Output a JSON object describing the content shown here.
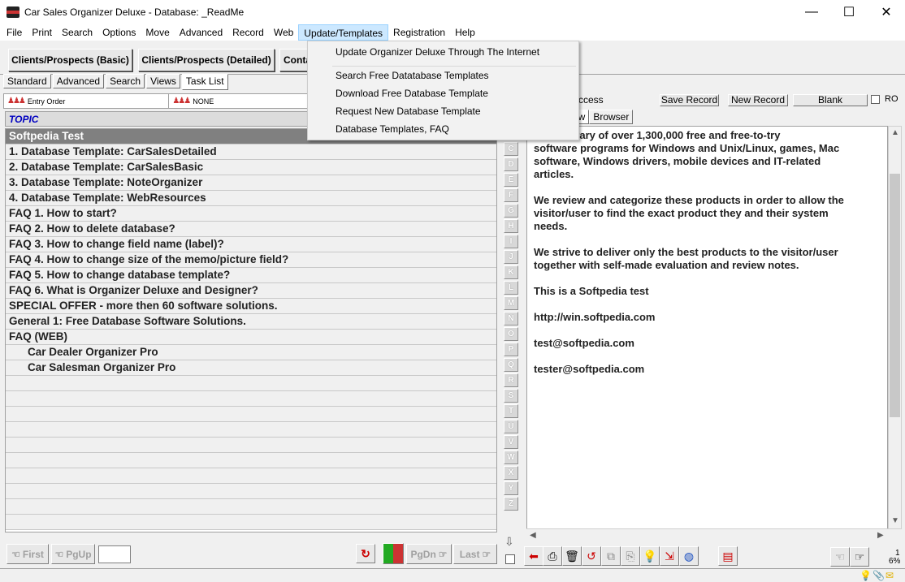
{
  "window": {
    "title": "Car Sales Organizer Deluxe - Database: _ReadMe",
    "controls": [
      "—",
      "☐",
      "✕"
    ]
  },
  "menu": [
    "File",
    "Print",
    "Search",
    "Options",
    "Move",
    "Advanced",
    "Record",
    "Web",
    "Update/Templates",
    "Registration",
    "Help"
  ],
  "active_menu": "Update/Templates",
  "dropdown": {
    "items": [
      "Update Organizer Deluxe Through The Internet",
      "Search Free Datatabase Templates",
      "Download Free Database Template",
      "Request New Database Template",
      "Database Templates, FAQ"
    ]
  },
  "toolbar": {
    "btn1": "Clients/Prospects (Basic)",
    "btn2": "Clients/Prospects (Detailed)",
    "btn3": "Conta"
  },
  "left_tabs": [
    "Standard",
    "Advanced",
    "Search",
    "Views",
    "Task List"
  ],
  "sort": {
    "left": "Entry Order",
    "right": "NONE"
  },
  "topic_header": "TOPIC",
  "rows": [
    "Softpedia Test",
    "1. Database Template: CarSalesDetailed",
    "2. Database Template: CarSalesBasic",
    "3. Database Template: NoteOrganizer",
    "4. Database Template: WebResources",
    "FAQ 1. How to start?",
    "FAQ 2. How to delete database?",
    "FAQ 3. How to change field name (label)?",
    "FAQ 4. How to change size of the memo/picture field?",
    "FAQ 5. How to change database template?",
    "FAQ 6. What is Organizer Deluxe and Designer?",
    "SPECIAL OFFER - more then 60 software solutions.",
    "General 1: Free Database Software Solutions.",
    "FAQ (WEB)",
    "Car Dealer Organizer Pro",
    "Car Salesman Organizer Pro"
  ],
  "alphabet": [
    "C",
    "D",
    "E",
    "F",
    "G",
    "H",
    "I",
    "J",
    "K",
    "L",
    "M",
    "N",
    "O",
    "P",
    "Q",
    "R",
    "S",
    "T",
    "U",
    "V",
    "W",
    "X",
    "Y",
    "Z"
  ],
  "nav": {
    "first": "First",
    "pgup": "PgUp",
    "pgdn": "PgDn",
    "last": "Last"
  },
  "right": {
    "label": "ccess",
    "save": "Save Record",
    "new": "New Record",
    "blank": "Blank",
    "ro": "RO",
    "tab1": "ew",
    "tab2": "Browser"
  },
  "memo": [
    "a is a library of over 1,300,000 free and free-to-try\nsoftware programs for Windows and Unix/Linux, games, Mac\nsoftware, Windows drivers, mobile devices and IT-related\narticles.",
    "We review and categorize these products in order to allow the\nvisitor/user to find the exact product they and their system\nneeds.",
    "We strive to deliver only the best products to the visitor/user\ntogether with self-made evaluation and review notes.",
    "This is a  Softpedia test",
    "http://win.softpedia.com",
    "test@softpedia.com",
    "tester@softpedia.com"
  ],
  "status": {
    "page": "1",
    "percent": "6%"
  }
}
